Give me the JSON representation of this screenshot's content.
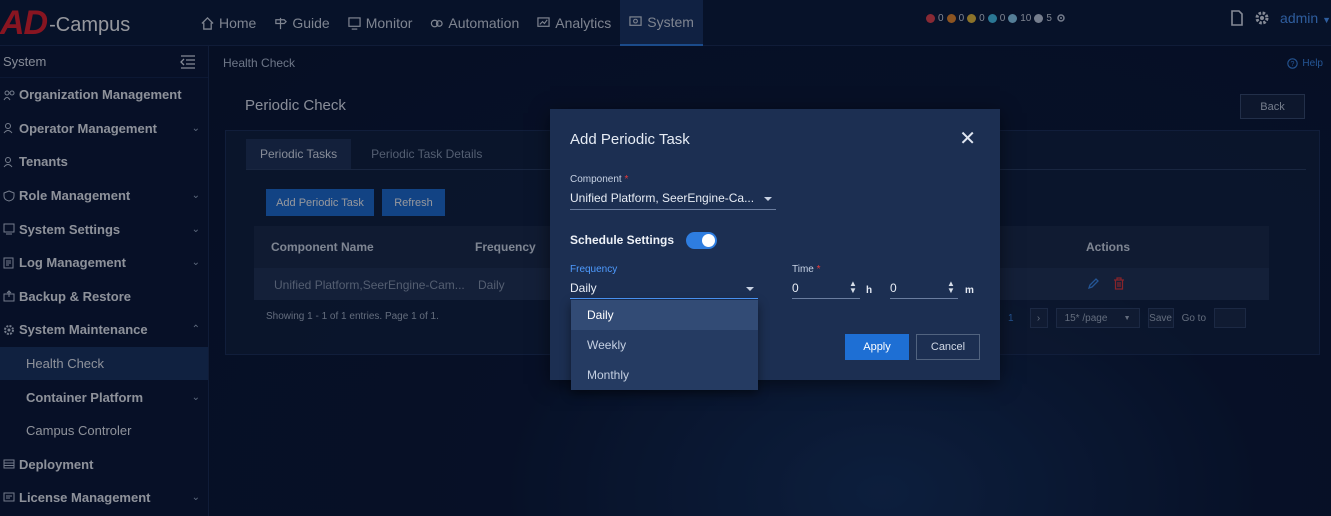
{
  "app": {
    "logo_ad": "AD",
    "logo_suffix": "-Campus"
  },
  "nav": [
    {
      "label": "Home"
    },
    {
      "label": "Guide"
    },
    {
      "label": "Monitor"
    },
    {
      "label": "Automation"
    },
    {
      "label": "Analytics"
    },
    {
      "label": "System"
    }
  ],
  "alarms": [
    {
      "count": "0",
      "color": "#e8434b"
    },
    {
      "count": "0",
      "color": "#f08c2a"
    },
    {
      "count": "0",
      "color": "#f0c23a"
    },
    {
      "count": "0",
      "color": "#48c8f0"
    },
    {
      "count": "10",
      "color": "#8fd4f5"
    },
    {
      "count": "5",
      "color": "#c9d3e3"
    }
  ],
  "user": {
    "name": "admin"
  },
  "sidebar": {
    "title": "System",
    "items": [
      {
        "label": "Organization Management"
      },
      {
        "label": "Operator Management"
      },
      {
        "label": "Tenants"
      },
      {
        "label": "Role Management"
      },
      {
        "label": "System Settings"
      },
      {
        "label": "Log Management"
      },
      {
        "label": "Backup & Restore"
      },
      {
        "label": "System Maintenance"
      },
      {
        "label": "Health Check"
      },
      {
        "label": "Container Platform"
      },
      {
        "label": "Campus Controler"
      },
      {
        "label": "Deployment"
      },
      {
        "label": "License Management"
      }
    ]
  },
  "main": {
    "breadcrumb": "Health Check",
    "help": "Help",
    "title": "Periodic Check",
    "back": "Back",
    "tabs": [
      {
        "label": "Periodic Tasks"
      },
      {
        "label": "Periodic Task Details"
      }
    ],
    "add_btn": "Add Periodic Task",
    "refresh_btn": "Refresh",
    "columns": {
      "component": "Component Name",
      "frequency": "Frequency",
      "actions": "Actions"
    },
    "rows": [
      {
        "component": "Unified Platform,SeerEngine-Cam...",
        "frequency": "Daily"
      }
    ],
    "footer": "Showing 1 - 1 of 1 entries. Page 1 of 1.",
    "pager": {
      "page": "1",
      "per_page": "15* /page",
      "save": "Save",
      "goto": "Go to"
    }
  },
  "dialog": {
    "title": "Add Periodic Task",
    "component_label": "Component",
    "component_value": "Unified Platform, SeerEngine-Ca...",
    "schedule_label": "Schedule Settings",
    "schedule_enabled": true,
    "frequency_label": "Frequency",
    "frequency_value": "Daily",
    "time_label": "Time",
    "hours": "0",
    "hours_unit": "h",
    "minutes": "0",
    "minutes_unit": "m",
    "apply": "Apply",
    "cancel": "Cancel"
  },
  "dropdown": {
    "options": [
      "Daily",
      "Weekly",
      "Monthly"
    ],
    "selected": "Daily"
  },
  "colors": {
    "accent": "#1e6fd4",
    "brand_red": "#e8202a",
    "danger": "#e83a3a"
  }
}
